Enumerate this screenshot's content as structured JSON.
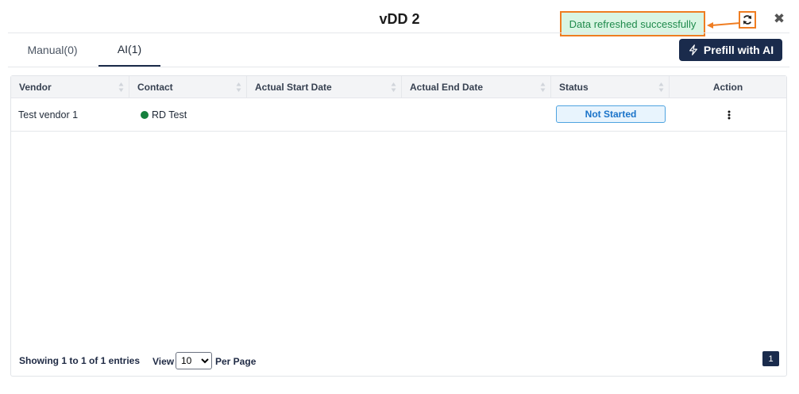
{
  "modal": {
    "title": "vDD 2"
  },
  "toast": {
    "message": "Data refreshed successfully"
  },
  "header": {
    "refresh_icon": "refresh-icon",
    "close_icon": "close-icon",
    "close_glyph": "✖"
  },
  "tabs": [
    {
      "label": "Manual(0)",
      "active": false
    },
    {
      "label": "AI(1)",
      "active": true
    }
  ],
  "prefill": {
    "label": "Prefill with AI",
    "icon": "lightning-icon"
  },
  "table": {
    "columns": [
      "Vendor",
      "Contact",
      "Actual Start Date",
      "Actual End Date",
      "Status",
      "Action"
    ],
    "rows": [
      {
        "vendor": "Test vendor 1",
        "contact": "RD Test",
        "actual_start_date": "",
        "actual_end_date": "",
        "status": "Not Started",
        "action_icon": "kebab-menu-icon"
      }
    ]
  },
  "pagination": {
    "info": "Showing 1 to 1 of 1 entries",
    "view_label": "View",
    "per_page_value": "10",
    "per_page_label": "Per Page",
    "current_page": "1"
  },
  "colors": {
    "primary": "#1a2b4c",
    "highlight": "#ef7d22",
    "toast_bg": "#d9f5e3",
    "toast_text": "#1f8a4c",
    "status_border": "#4ea3e0",
    "status_text": "#1a73c9",
    "contact_dot": "#15803d"
  }
}
